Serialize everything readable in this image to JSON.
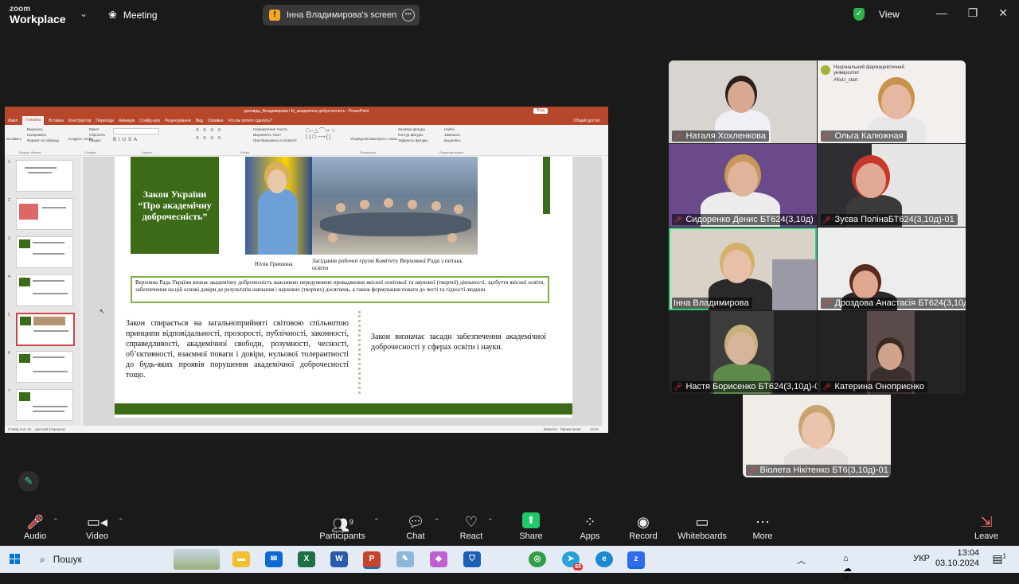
{
  "zoom": {
    "logo_top": "zoom",
    "logo_bottom": "Workplace",
    "meeting_label": "Meeting",
    "share_label": "Інна Владимирова's screen",
    "view_label": "View"
  },
  "ppt": {
    "window_title": "доповідь_Владимирова і М_академічна доброчесність - PowerPoint",
    "login_btn": "Вхід",
    "tabs": [
      "Файл",
      "Головна",
      "Вставка",
      "Конструктор",
      "Переходи",
      "Анімація",
      "Слайд-шоу",
      "Рецензування",
      "Вид",
      "Справка"
    ],
    "tell_me": "Что вы хотите сделать?",
    "share": "Общий доступ",
    "ribbon": {
      "paste": "Вставить",
      "cut": "Вырезать",
      "copy": "Копировать",
      "format_painter": "Формат по образцу",
      "clipboard": "Буфер обмена",
      "new_slide": "Создать слайд",
      "layout": "Макет",
      "reset": "Сбросить",
      "section": "Раздел",
      "slides": "Слайды",
      "font": "Шрифт",
      "paragraph": "Абзац",
      "text_dir": "Направление текста",
      "align_text": "Выровнять текст",
      "smartart": "Преобразовать в SmartArt",
      "arrange": "Упорядочить",
      "quick_styles": "Экспресс-стили",
      "shape_fill": "Заливка фигуры",
      "shape_outline": "Контур фигуры",
      "shape_effects": "Эффекты фигуры",
      "drawing": "Рисование",
      "find": "Найти",
      "replace": "Заменить",
      "select": "Выделить",
      "editing": "Редактирование"
    },
    "thumb_numbers": [
      "1",
      "2",
      "3",
      "4",
      "5",
      "6",
      "7"
    ],
    "slide": {
      "green_title": "Закон України “Про академічну доброчесність”",
      "caption_left": "Юлія Гришина",
      "caption_right": "Засідання робочої групи Комітету Верховної Ради з питань освіти",
      "box_text": "Верховна Рада України визнає академічну доброчесність важливою передумовою провадження якісної освітньої та наукової (творчої) діяльності, здобуття якісної освіти, забезпечення на цій основі довіри до результатів навчання і наукових (творчих) досягнень, а також формування поваги до честі та гідності людини.",
      "left_text": "Закон спирається на загальноприйняті світовою спільнотою принципи відповідальності, прозорості, публічності, законності, справедливості, академічної свободи, розумності, чесності, об’єктивності, взаємної поваги і довіри, нульової толерантності до будь-яких проявів порушення академічної доброчесності тощо.",
      "right_text": "Закон визначає засади забезпечення академічної доброчесності у сферах освіти і науки."
    },
    "status": {
      "slide_num": "Слайд 5 из 15",
      "language": "русский (Украина)",
      "notes": "Заметки",
      "comments": "Примечания",
      "zoom": "114%"
    }
  },
  "participants": [
    {
      "name": "Наталя Хохленкова",
      "muted": true
    },
    {
      "name": "Ольга Калюжная",
      "muted": true,
      "logo_text": "Національний фармацевтичний університет",
      "hashtag": "#NuU_start"
    },
    {
      "name": "Сидоренко Денис  БТ624(3,10д)",
      "muted": true
    },
    {
      "name": "Зуєва ПолінаБТ624(3,10д)-01",
      "muted": true
    },
    {
      "name": "Інна Владимирова",
      "muted": false
    },
    {
      "name": "Дроздова Анастасія БТ624(3,10д)...",
      "muted": true
    },
    {
      "name": "Настя Борисенко БТ624(3,10д)-01",
      "muted": true
    },
    {
      "name": "Катерина Оноприєнко",
      "muted": true
    },
    {
      "name": "Віолета Нікітенко БТ6(3,10д)-01",
      "muted": true
    }
  ],
  "toolbar": {
    "audio": "Audio",
    "video": "Video",
    "participants": "Participants",
    "participants_count": "9",
    "chat": "Chat",
    "react": "React",
    "share": "Share",
    "apps": "Apps",
    "record": "Record",
    "whiteboards": "Whiteboards",
    "more": "More",
    "leave": "Leave"
  },
  "taskbar": {
    "search": "Пошук",
    "language": "УКР",
    "time": "13:04",
    "date": "03.10.2024",
    "notifications": "1",
    "telegram_badge": "65"
  },
  "colors": {
    "zoom_bg": "#1a1a1a",
    "ppt_red": "#b7472a",
    "slide_green": "#3b6b16",
    "active_speaker": "#2bd17d"
  }
}
